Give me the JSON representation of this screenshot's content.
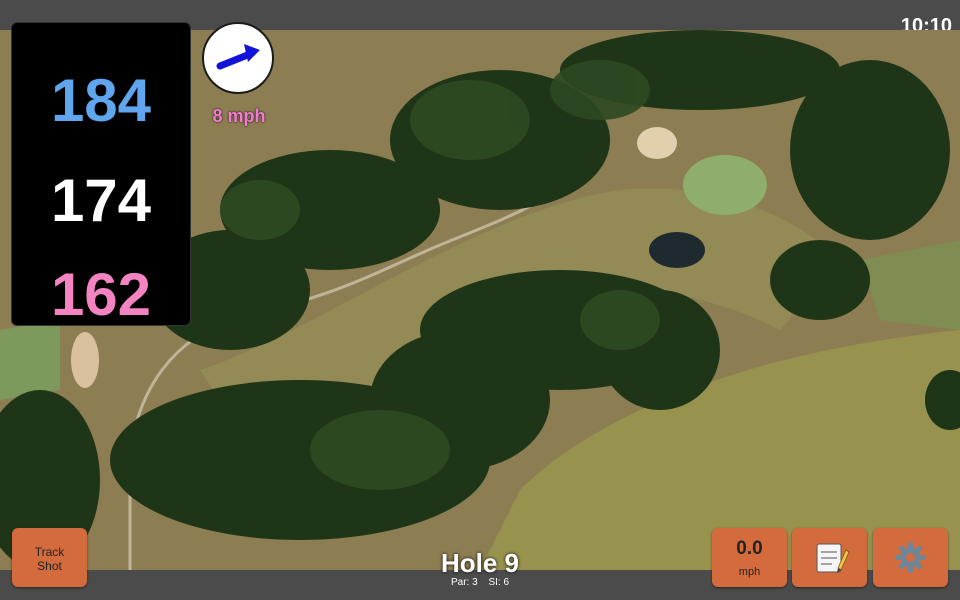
{
  "status_bar": {
    "time": "10:10"
  },
  "distances": {
    "back": "184",
    "middle": "174",
    "front": "162"
  },
  "wind": {
    "speed_label": "8 mph",
    "direction_icon": "arrow-up-right-icon"
  },
  "hole": {
    "title": "Hole 9",
    "par": "Par: 3",
    "stroke_index": "SI: 6"
  },
  "toolbar": {
    "track_shot_line1": "Track",
    "track_shot_line2": "Shot",
    "wind_value": "0.0",
    "wind_unit": "mph",
    "notes_icon": "notepad-icon",
    "settings_icon": "gear-icon"
  },
  "colors": {
    "back_distance": "#5fa6ee",
    "middle_distance": "#ffffff",
    "front_distance": "#f483c2",
    "button": "#d46b3d",
    "wind_text": "#f27ad4"
  }
}
